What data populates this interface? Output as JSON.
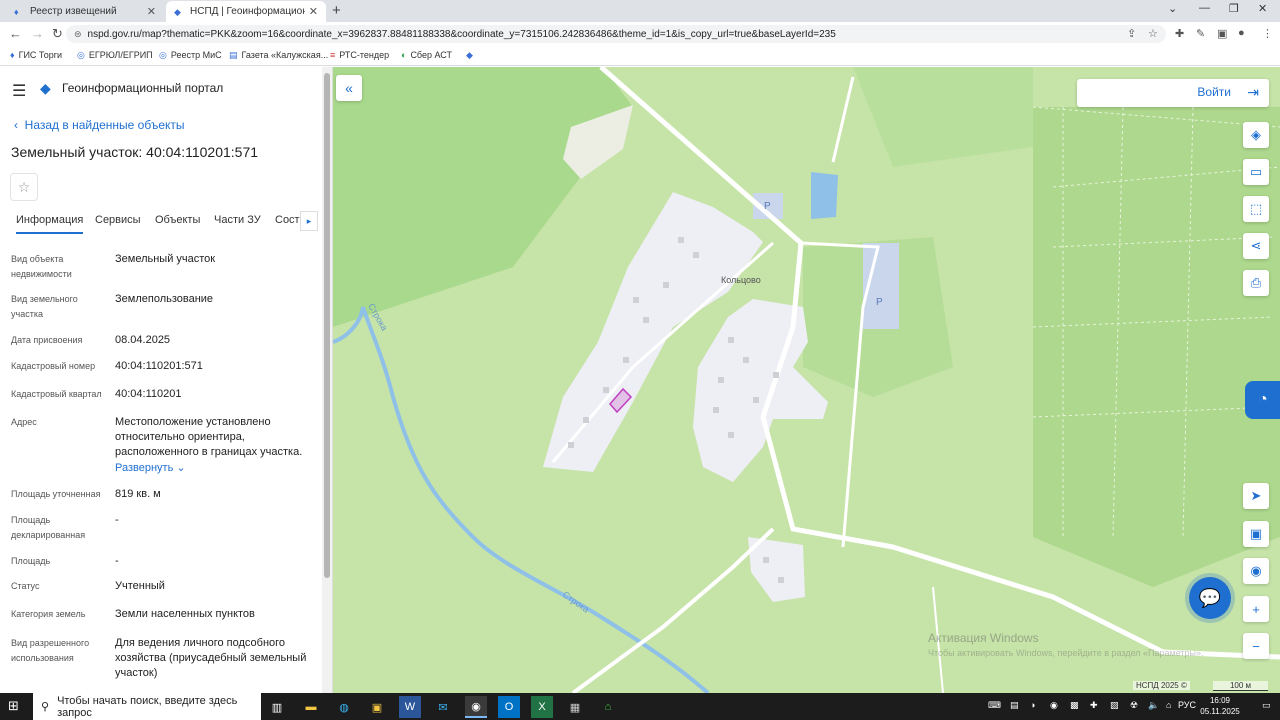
{
  "browser": {
    "tabs": [
      {
        "title": "Реестр извещений"
      },
      {
        "title": "НСПД | Геоинформационный п"
      }
    ],
    "url": "nspd.gov.ru/map?thematic=PKK&zoom=16&coordinate_x=3962837.88481188338&coordinate_y=7315106.242836486&theme_id=1&is_copy_url=true&baseLayerId=235",
    "bookmarks": [
      "ГИС Торги",
      "ЕГРЮЛ/ЕГРИП",
      "Реестр МиС",
      "Газета «Калужская...",
      "РТС-тендер",
      "Сбер АСТ"
    ]
  },
  "panel": {
    "app_title": "Геоинформационный портал",
    "back_label": "Назад в найденные объекты",
    "page_title": "Земельный участок: 40:04:110201:571",
    "tabs": [
      "Информация",
      "Сервисы",
      "Объекты",
      "Части ЗУ",
      "Соста"
    ],
    "properties": [
      {
        "label": "Вид объекта недвижимости",
        "value": "Земельный участок"
      },
      {
        "label": "Вид земельного участка",
        "value": "Землепользование"
      },
      {
        "label": "Дата присвоения",
        "value": "08.04.2025"
      },
      {
        "label": "Кадастровый номер",
        "value": "40:04:110201:571"
      },
      {
        "label": "Кадастровый квартал",
        "value": "40:04:110201"
      },
      {
        "label": "Адрес",
        "value": "Местоположение установлено относительно ориентира, расположенного в границах участка."
      },
      {
        "label": "Площадь уточненная",
        "value": "819 кв. м"
      },
      {
        "label": "Площадь декларированная",
        "value": "-"
      },
      {
        "label": "Площадь",
        "value": "-"
      },
      {
        "label": "Статус",
        "value": "Учтенный"
      },
      {
        "label": "Категория земель",
        "value": "Земли населенных пунктов"
      },
      {
        "label": "Вид разрешенного использования",
        "value": "Для ведения личного подсобного хозяйства (приусадебный земельный участок)"
      }
    ],
    "expand_label": "Развернуть"
  },
  "map": {
    "login_label": "Войти",
    "village_label": "Кольцово",
    "river_label_1": "Строка",
    "river_label_2": "Строка",
    "parking_label": "P",
    "watermark_title": "Активация Windows",
    "watermark_sub": "Чтобы активировать Windows, перейдите в раздел «Параметры».",
    "footer": "НСПД 2025 ©",
    "scale": "100 м",
    "colors": {
      "forest": "#c6e3a8",
      "field": "#a8d88a",
      "settlement": "#eeeef5",
      "water": "#8ec0e8",
      "road": "#ffffff",
      "parcel": "#c040c0",
      "accent": "#1f6fd1"
    }
  },
  "taskbar": {
    "search_placeholder": "Чтобы начать поиск, введите здесь запрос",
    "lang": "РУС",
    "time": "16:09",
    "date": "05.11.2025"
  }
}
